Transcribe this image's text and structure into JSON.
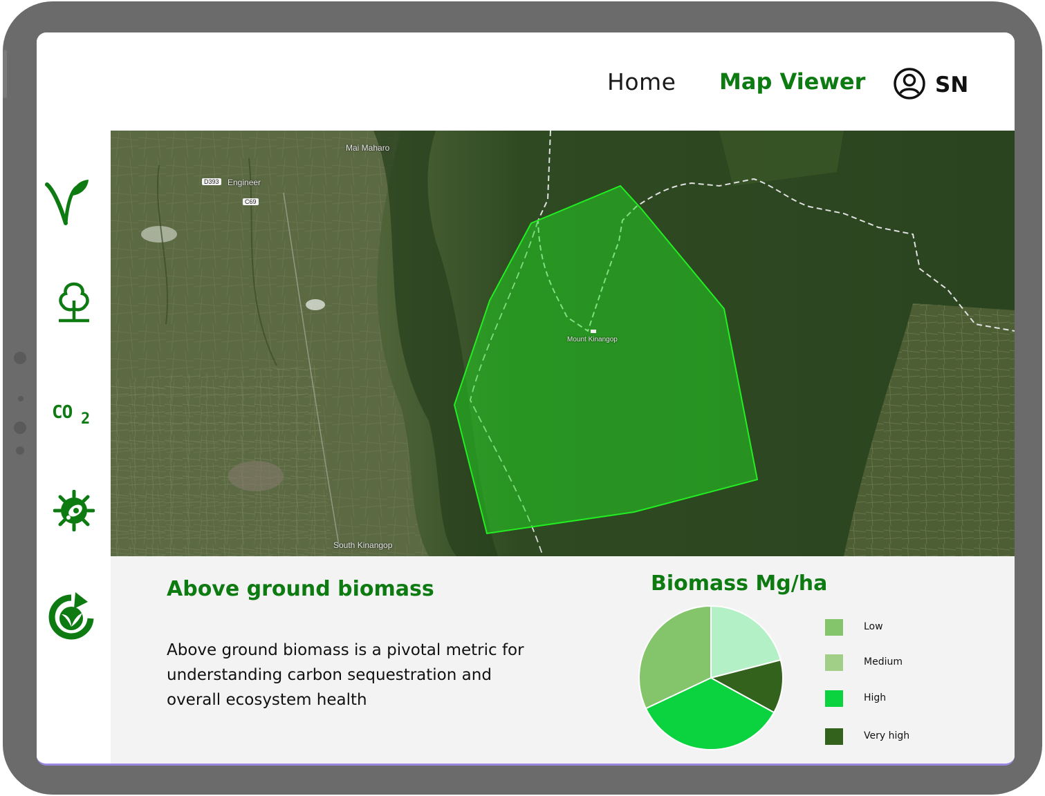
{
  "nav": {
    "home": "Home",
    "map_viewer": "Map Viewer",
    "user_initials": "SN"
  },
  "sidebar": {
    "icons": [
      "vegetation-icon",
      "tree-icon",
      "co2-icon",
      "bug-icon",
      "recycle-leaf-icon"
    ],
    "co2_text": "CO",
    "co2_sub": "2"
  },
  "map": {
    "labels": {
      "mai_maharo": "Mai Maharo",
      "engineer": "Engineer",
      "mount_kinangop": "Mount Kinangop",
      "south_kinangop": "South Kinangop"
    },
    "road_badges": {
      "d393": "D393",
      "c69": "C69"
    }
  },
  "info": {
    "title": "Above ground biomass",
    "description": "Above ground biomass is a pivotal metric for understanding carbon sequestration and overall ecosystem health"
  },
  "chart_data": {
    "type": "pie",
    "title": "Biomass Mg/ha",
    "categories": [
      "Low",
      "Medium",
      "High",
      "Very high"
    ],
    "values": [
      32,
      21,
      35,
      12
    ],
    "colors": [
      "#84c46b",
      "#b4f0c6",
      "#0bd23f",
      "#33621c"
    ],
    "legend_colors": [
      "#84c46b",
      "#a1cf88",
      "#0bd23f",
      "#33621c"
    ],
    "legend_placement": "right"
  },
  "colors": {
    "accent": "#0e7a12",
    "polygon": "#22dd22"
  }
}
